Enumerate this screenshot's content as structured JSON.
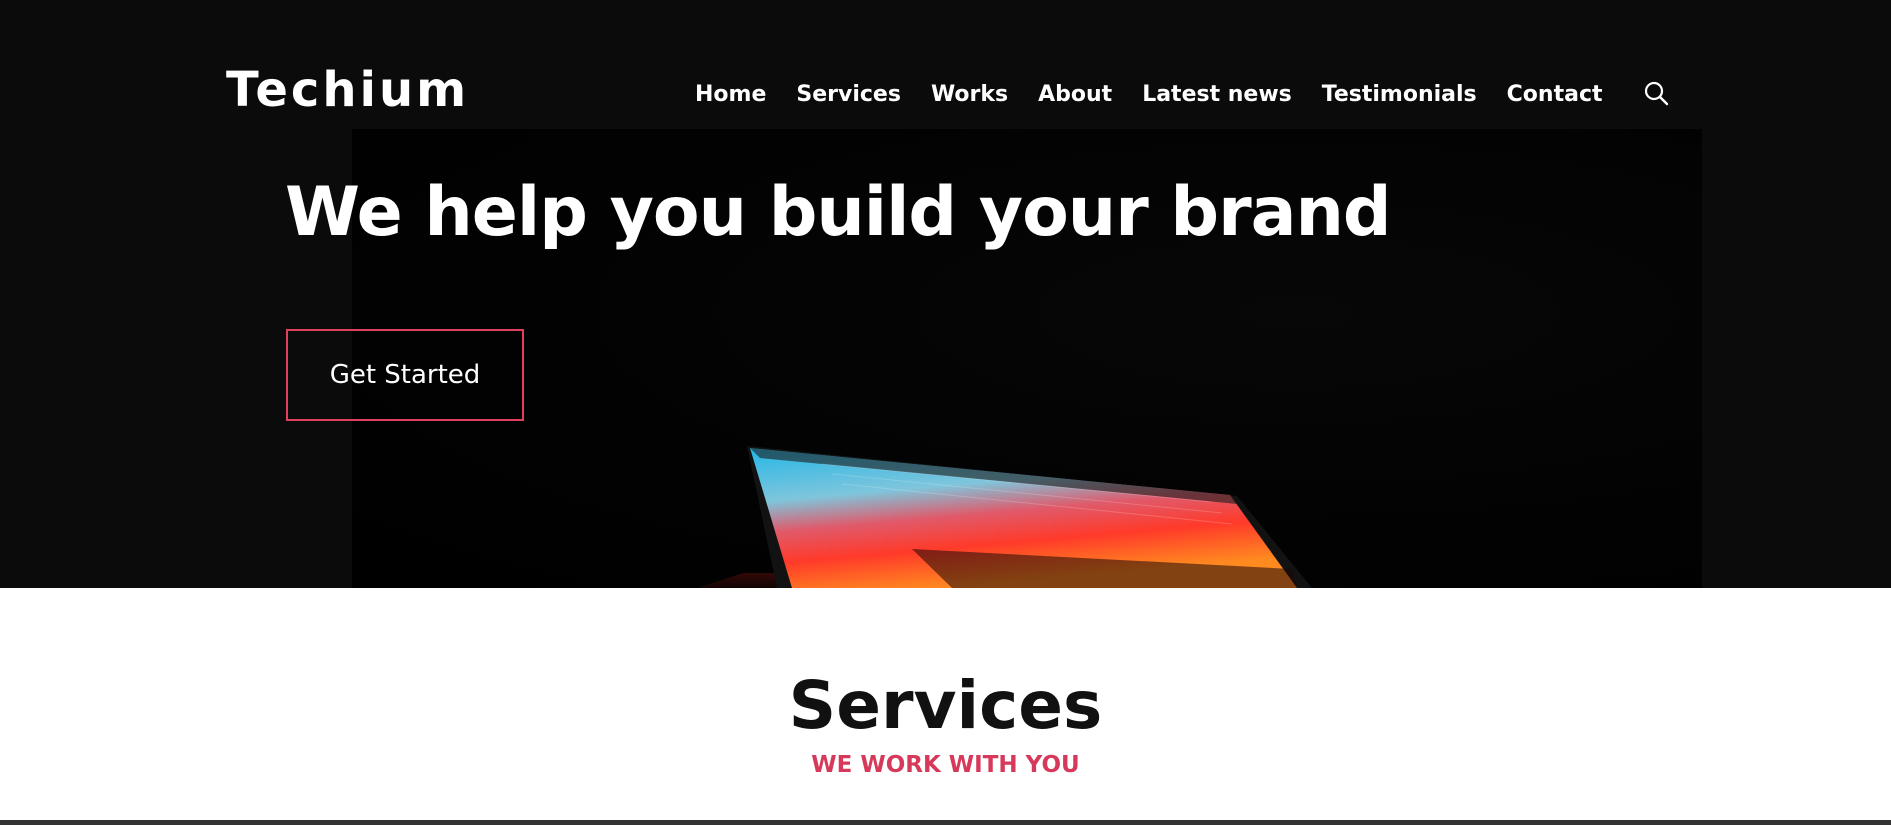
{
  "brand": {
    "logo_text": "Techium"
  },
  "nav": {
    "items": [
      {
        "label": "Home"
      },
      {
        "label": "Services"
      },
      {
        "label": "Works"
      },
      {
        "label": "About"
      },
      {
        "label": "Latest news"
      },
      {
        "label": "Testimonials"
      },
      {
        "label": "Contact"
      }
    ],
    "search_icon": "search-icon"
  },
  "hero": {
    "title": "We help you build your brand",
    "cta_label": "Get Started",
    "background_image": "laptop-screen-photo"
  },
  "services": {
    "title": "Services",
    "subtitle": "WE WORK WITH YOU"
  },
  "colors": {
    "accent": "#e0405e",
    "subtitle": "#d6395a",
    "hero_bg": "#0b0b0b",
    "text_light": "#ffffff",
    "text_dark": "#111111"
  }
}
